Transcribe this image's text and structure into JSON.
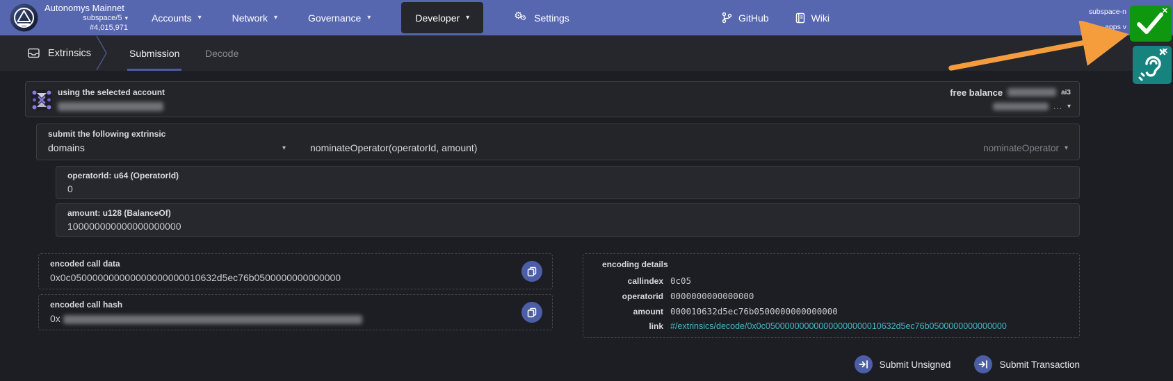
{
  "topnav": {
    "brand": {
      "title": "Autonomys Mainnet",
      "chain": "subspace/5",
      "block_number": "#4,015,971"
    },
    "menu": {
      "accounts": "Accounts",
      "network": "Network",
      "governance": "Governance",
      "developer": "Developer",
      "settings": "Settings"
    },
    "links": {
      "github": "GitHub",
      "wiki": "Wiki"
    },
    "meta": {
      "line1": "subspace-n",
      "line2": "apps v"
    }
  },
  "tabbar": {
    "section": "Extrinsics",
    "tabs": {
      "submission": "Submission",
      "decode": "Decode"
    }
  },
  "account": {
    "label": "using the selected account",
    "free_balance_label": "free balance",
    "unit": "ai3",
    "ellipsis": "..."
  },
  "extrinsic": {
    "label": "submit the following extrinsic",
    "pallet": "domains",
    "signature": "nominateOperator(operatorId, amount)",
    "method": "nominateOperator"
  },
  "params": {
    "operator": {
      "label": "operatorId: u64 (OperatorId)",
      "value": "0"
    },
    "amount": {
      "label": "amount: u128 (BalanceOf)",
      "value": "100000000000000000000"
    }
  },
  "outputs": {
    "call_data_label": "encoded call data",
    "call_data": "0x0c050000000000000000000010632d5ec76b0500000000000000",
    "call_hash_label": "encoded call hash",
    "call_hash_prefix": "0x"
  },
  "encoding": {
    "title": "encoding details",
    "callindex_label": "callindex",
    "callindex": "0c05",
    "operatorid_label": "operatorid",
    "operatorid": "0000000000000000",
    "amount_label": "amount",
    "amount": "000010632d5ec76b0500000000000000",
    "link_label": "link",
    "link": "#/extrinsics/decode/0x0c050000000000000000000010632d5ec76b0500000000000000"
  },
  "actions": {
    "unsigned": "Submit Unsigned",
    "transaction": "Submit Transaction"
  },
  "glyphs": {
    "caret": "▾",
    "close": "✕"
  },
  "colors": {
    "navbar": "#5667b0",
    "bar": "#26272c",
    "page": "#1d1e23",
    "accent": "#4d5ea8",
    "success_green": "#0f970f",
    "accessibility_teal": "#17837f",
    "annotation_orange": "#f59d3d",
    "link_teal": "#45b6c4"
  }
}
